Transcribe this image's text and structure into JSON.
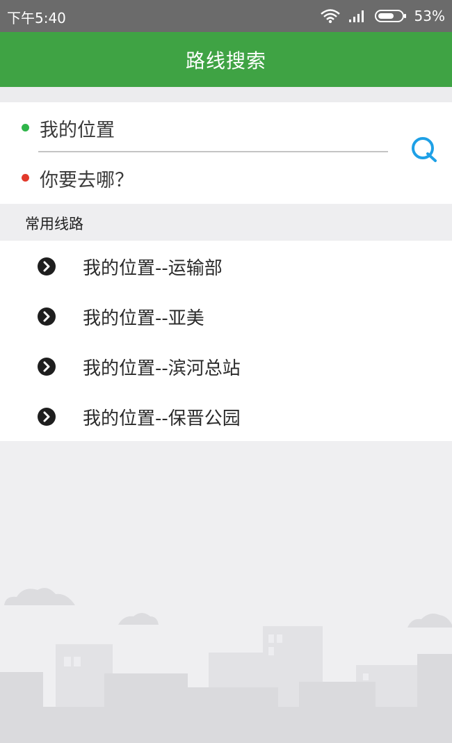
{
  "status_bar": {
    "time": "下午5:40",
    "battery": "53%"
  },
  "header": {
    "title": "路线搜索"
  },
  "search": {
    "from": "我的位置",
    "to": "你要去哪？"
  },
  "common_routes": {
    "title": "常用线路",
    "items": [
      {
        "label": "我的位置--运输部"
      },
      {
        "label": "我的位置--亚美"
      },
      {
        "label": "我的位置--滨河总站"
      },
      {
        "label": "我的位置--保晋公园"
      }
    ]
  },
  "colors": {
    "title_bar": "#3fa344",
    "status_bar": "#6b6b6b",
    "start_dot": "#2fb54a",
    "end_dot": "#e2392b",
    "search_icon": "#1ea0e6"
  },
  "icons": [
    "wifi-icon",
    "signal-icon",
    "battery-icon",
    "search-icon",
    "chevron-right-icon"
  ]
}
